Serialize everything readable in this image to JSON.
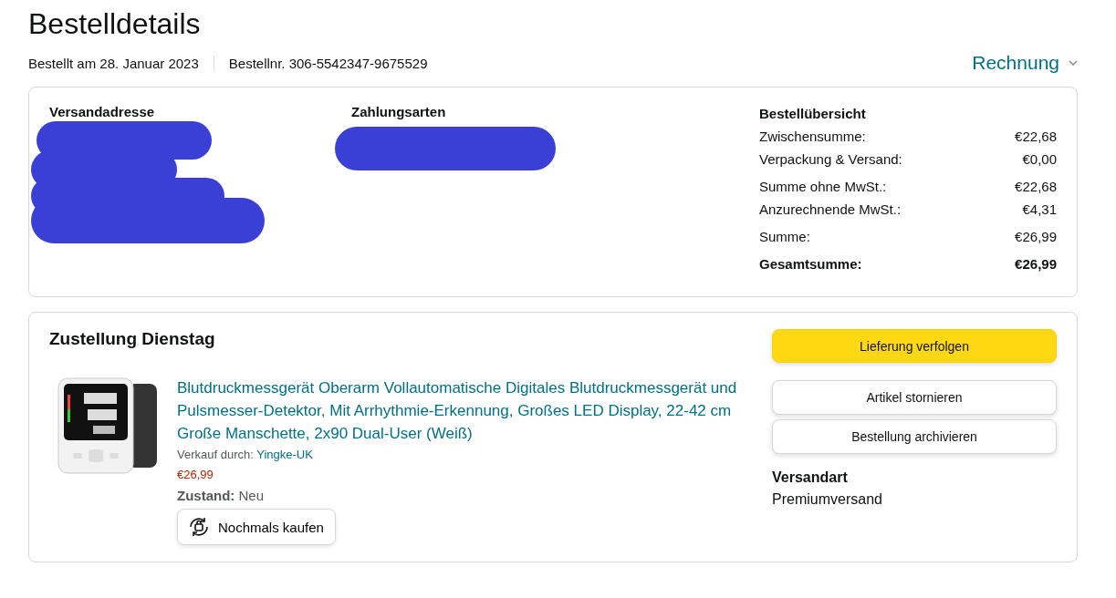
{
  "page_title": "Bestelldetails",
  "order_meta": [
    "Bestellt am 28. Januar 2023",
    "Bestellnr. 306-5542347-9675529"
  ],
  "invoice_menu": {
    "label": "Rechnung"
  },
  "summary_card": {
    "shipping_address": {
      "heading": "Versandadresse"
    },
    "payment": {
      "heading": "Zahlungsarten"
    },
    "overview": {
      "heading": "Bestellübersicht",
      "groups": [
        [
          {
            "label": "Zwischensumme:",
            "value": "€22,68",
            "kind": "line"
          },
          {
            "label": "Verpackung & Versand:",
            "value": "€0,00",
            "kind": "line"
          }
        ],
        [
          {
            "label": "Summe ohne MwSt.:",
            "value": "€22,68",
            "kind": "line"
          },
          {
            "label": "Anzurechnende MwSt.:",
            "value": "€4,31",
            "kind": "line"
          }
        ],
        [
          {
            "label": "Summe:",
            "value": "€26,99",
            "kind": "line"
          }
        ],
        [
          {
            "label": "Gesamtsumme:",
            "value": "€26,99",
            "kind": "total"
          }
        ]
      ]
    }
  },
  "shipment": {
    "heading": "Zustellung Dienstag",
    "item": {
      "title": "Blutdruckmessgerät Oberarm Vollautomatische Digitales Blutdruckmessgerät und Pulsmesser-Detektor, Mit Arrhythmie-Erkennung, Großes LED Display, 22-42 cm Große Manschette, 2x90 Dual-User (Weiß)",
      "seller_label": "Verkauf durch:",
      "seller": "Yingke-UK",
      "price": "€26,99",
      "condition_label": "Zustand:",
      "condition": "Neu",
      "buy_again": "Nochmals kaufen"
    },
    "actions": [
      {
        "label": "Lieferung verfolgen",
        "kind": "primary"
      },
      {
        "label": "Artikel stornieren",
        "kind": "secondary"
      },
      {
        "label": "Bestellung archivieren",
        "kind": "secondary"
      }
    ],
    "shipping_method": {
      "heading": "Versandart",
      "value": "Premiumversand"
    }
  }
}
